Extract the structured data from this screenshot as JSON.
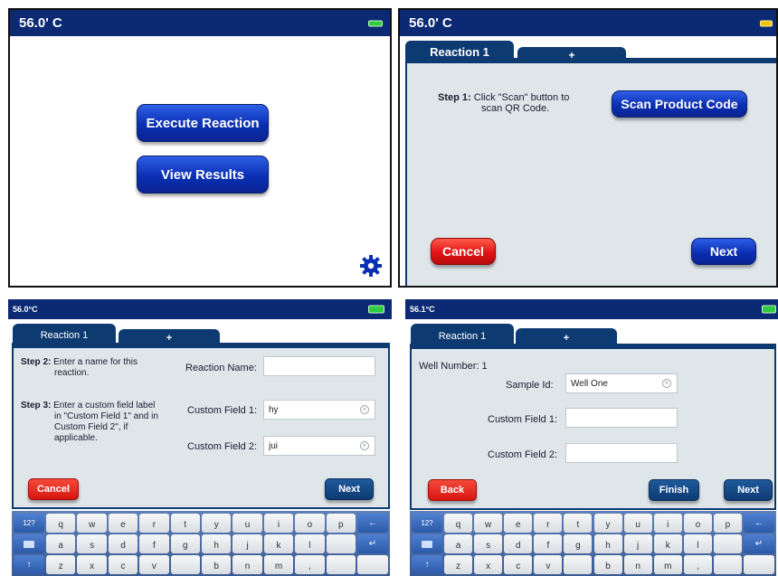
{
  "panel1": {
    "temperature": "56.0' C",
    "execute_label": "Execute Reaction",
    "view_label": "View Results"
  },
  "panel2": {
    "temperature": "56.0' C",
    "tab_active": "Reaction 1",
    "tab_add": "+",
    "step1_bold": "Step 1:",
    "step1_text_line1": "Click \"Scan\" button to",
    "step1_text_line2": "scan QR Code.",
    "scan_label": "Scan Product Code",
    "cancel_label": "Cancel",
    "next_label": "Next"
  },
  "panel3": {
    "temperature": "56.0°C",
    "tab_active": "Reaction 1",
    "tab_add": "+",
    "step2_bold": "Step 2:",
    "step2_line1": "Enter a name for this",
    "step2_line2": "reaction.",
    "step3_bold": "Step 3:",
    "step3_line1": "Enter a custom field label",
    "step3_line2": "in \"Custom Field 1\" and in",
    "step3_line3": "Custom Field 2\", if",
    "step3_line4": "applicable.",
    "reaction_name_label": "Reaction Name:",
    "reaction_name_value": "",
    "custom1_label": "Custom Field 1:",
    "custom1_value": "hy",
    "custom2_label": "Custom Field 2:",
    "custom2_value": "jui",
    "cancel_label": "Cancel",
    "next_label": "Next"
  },
  "panel4": {
    "temperature": "56.1°C",
    "tab_active": "Reaction 1",
    "tab_add": "+",
    "well_number": "Well Number: 1",
    "sample_label": "Sample Id:",
    "sample_value": "Well One",
    "custom1_label": "Custom Field 1:",
    "custom2_label": "Custom Field 2:",
    "back_label": "Back",
    "finish_label": "Finish",
    "next_label": "Next"
  },
  "keyboard": {
    "row1": [
      "q",
      "w",
      "e",
      "r",
      "t",
      "y",
      "u",
      "i",
      "o",
      "p"
    ],
    "row2": [
      "a",
      "s",
      "d",
      "f",
      "g",
      "h",
      "j",
      "k",
      "l",
      ""
    ],
    "row3": [
      "z",
      "x",
      "c",
      "v",
      "",
      "b",
      "n",
      "m",
      ","
    ],
    "mode_key": "12?"
  },
  "colors": {
    "statusbar": "#0b2a73",
    "button_blue": "#0a2fb3",
    "button_red": "#e11414",
    "content_bg": "#dfe6ea",
    "keyboard_bg": "#3a5a93"
  }
}
